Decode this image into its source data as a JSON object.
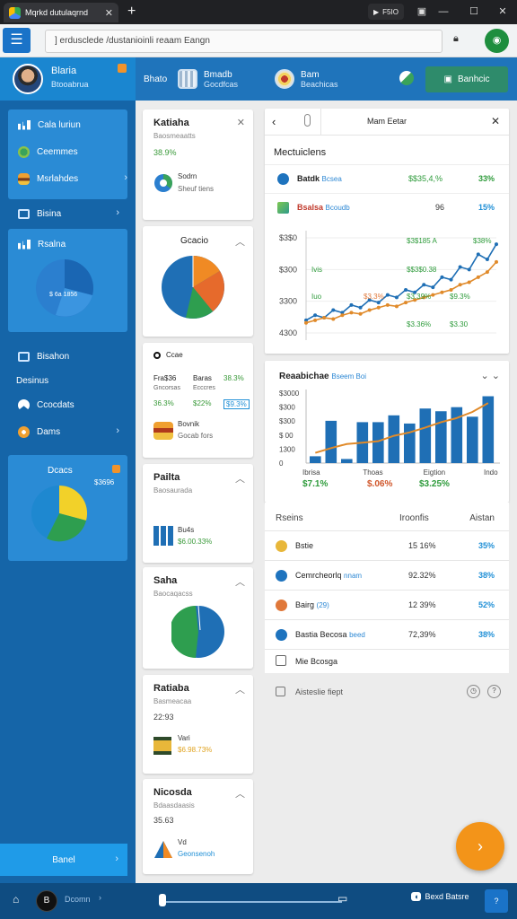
{
  "browser": {
    "tab_title": "Mqrkd dutulaqrnd",
    "url": "] erdusclede /dustanioinli reaam Eangn",
    "pill_label": "F5IO"
  },
  "profile": {
    "name": "Blaria",
    "subtitle": "Btooabrua"
  },
  "sidebar": {
    "group1": [
      {
        "label": "Cala luriun",
        "icon": "chart-bars-icon"
      },
      {
        "label": "Ceemmes",
        "icon": "green-circle-icon"
      },
      {
        "label": "Msrlahdes",
        "icon": "burger-icon"
      }
    ],
    "item_bisina": "Bisina",
    "box_label": "Rsalna",
    "box_pie_label": "$ 6a 1856",
    "item_bisahon": "Bisahon",
    "item_desinus": "Desinus",
    "item_ccocdats": "Ccocdats",
    "item_dams": "Dams",
    "box2_label": "Dcacs",
    "box2_value": "$3696",
    "bottom_button": "Banel"
  },
  "topstrip": {
    "item1": "Bhato",
    "item2_title": "Bmadb",
    "item2_sub": "Gocdfcas",
    "item3_title": "Bam",
    "item3_sub": "Beachicas",
    "action": "Banhcic"
  },
  "cards": [
    {
      "title": "Katiaha",
      "sub": "Baosmeaatts",
      "value": "38.9%",
      "small1": "Sodrn",
      "small2": "Sheuf tiens"
    },
    {
      "title": "Gcacio"
    },
    {
      "title": "Ccae",
      "row1a": "Fra$36",
      "row1b": "Gncorsas",
      "row1c": "Baras",
      "row1d": "Ecccres",
      "v1": "38.3%",
      "v2": "36.3%",
      "v3": "$22%",
      "v4": "$9.3%",
      "small1": "Bovnik",
      "small2": "Gocab fors"
    },
    {
      "title": "Pailta",
      "sub": "Baosaurada",
      "small1": "Bu4s",
      "small2": "$6.00.33%"
    },
    {
      "title": "Saha",
      "sub": "Baocaqacss"
    },
    {
      "title": "Ratiaba",
      "sub": "Basmeacaa",
      "value": "22:93",
      "small1": "Vari",
      "small2": "$6.98.73%"
    },
    {
      "title": "Nicosda",
      "sub": "Bdaasdaasis",
      "value": "35.63",
      "small1": "Vd",
      "small2": "Geonsenoh"
    }
  ],
  "panel": {
    "title": "Mam Eetar",
    "section": "Mectuiclens",
    "rows": [
      {
        "name": "Batdk",
        "tag": "Bcsea",
        "value": "$$35,4,%",
        "pct": "33%",
        "color": "#1e73be"
      },
      {
        "name": "Bsalsa",
        "tag": "Bcoudb",
        "value": "96",
        "pct": "15%",
        "color": "#2e9b8b"
      }
    ]
  },
  "chart_data": [
    {
      "type": "line",
      "y_ticks": [
        "$3$0",
        "$300",
        "3300",
        "4300"
      ],
      "labels": [
        {
          "text": "$3$185 A",
          "color": "#2e9b3b"
        },
        {
          "text": "$38%",
          "color": "#2e9b3b"
        },
        {
          "text": "Ivis",
          "color": "#2e9b3b"
        },
        {
          "text": "$$3$0.38",
          "color": "#2e9b3b"
        },
        {
          "text": "Iuo",
          "color": "#2e9b3b"
        },
        {
          "text": "$9.3%",
          "color": "#2e9b3b"
        },
        {
          "text": "$3.39%",
          "color": "#2e9b3b"
        },
        {
          "text": "$3.3%",
          "color": "#e0783a"
        },
        {
          "text": "$3.36%",
          "color": "#2e9b3b"
        },
        {
          "text": "$3.30",
          "color": "#2e9b3b"
        }
      ],
      "series": [
        {
          "values": [
            10,
            14,
            12,
            18,
            16,
            22,
            20,
            26,
            24,
            30,
            28,
            34,
            32,
            38,
            36,
            44,
            42,
            52,
            50,
            62,
            58,
            70
          ],
          "color": "#1f6fb5"
        },
        {
          "values": [
            8,
            10,
            12,
            11,
            14,
            16,
            15,
            18,
            20,
            22,
            21,
            24,
            26,
            28,
            30,
            32,
            34,
            38,
            40,
            44,
            48,
            56
          ],
          "color": "#e08a2a"
        }
      ]
    },
    {
      "type": "bar",
      "title": "Reaabichae",
      "title_tag": "Bseem Boi",
      "y_ticks": [
        "$3000",
        "$300",
        "$300",
        "$ 00",
        "1300",
        "0"
      ],
      "x_labels": [
        "Ibrisa",
        "Thoas",
        "Eigtion",
        "Indo"
      ],
      "values": [
        10,
        62,
        6,
        60,
        60,
        70,
        58,
        80,
        76,
        82,
        68,
        98
      ],
      "line": [
        15,
        22,
        28,
        30,
        32,
        40,
        45,
        52,
        60,
        66,
        75,
        88
      ],
      "bar_color": "#1f6fb5",
      "line_color": "#e08a2a",
      "footer": [
        {
          "text": "$7.1%",
          "color": "#2e9b3b"
        },
        {
          "text": "$.06%",
          "color": "#d0562a"
        },
        {
          "text": "$3.25%",
          "color": "#2e9b3b"
        }
      ]
    }
  ],
  "table": {
    "headers": [
      "Rseins",
      "Iroonfis",
      "Aistan"
    ],
    "rows": [
      {
        "name": "Bstie",
        "tag": "",
        "v1": "15 16%",
        "v2": "35%",
        "color": "#e8b73a"
      },
      {
        "name": "Cemrcheorlq",
        "tag": "nnam",
        "v1": "92.32%",
        "v2": "38%",
        "color": "#1e73be"
      },
      {
        "name": "Bairg",
        "tag": "(29)",
        "v1": "12 39%",
        "v2": "52%",
        "color": "#e0783a"
      },
      {
        "name": "Bastia Becosa",
        "tag": "beed",
        "v1": "72,39%",
        "v2": "38%",
        "color": "#1e73be"
      }
    ],
    "more": "Mie Bcosga"
  },
  "footer_row": "Aisteslie fiept",
  "bottombar": {
    "badge": "B",
    "left_label": "Dcomn",
    "right_label": "Bexd Batsre"
  }
}
